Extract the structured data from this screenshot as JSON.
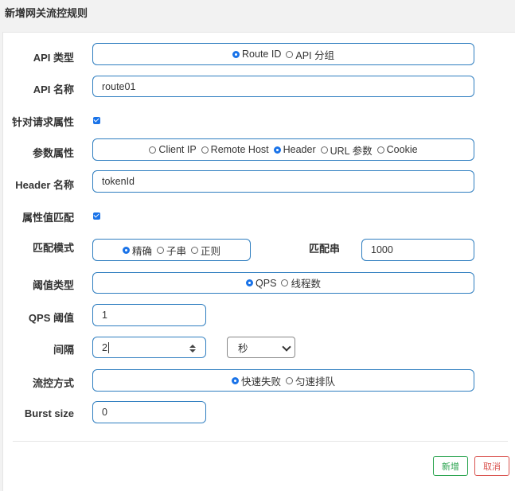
{
  "modal": {
    "title": "新增网关流控规则"
  },
  "form": {
    "api_type": {
      "label": "API 类型",
      "options": [
        "Route ID",
        "API 分组"
      ],
      "selected": "Route ID"
    },
    "api_name": {
      "label": "API 名称",
      "value": "route01"
    },
    "request_attr": {
      "label": "针对请求属性",
      "checked": true
    },
    "param_attr": {
      "label": "参数属性",
      "options": [
        "Client IP",
        "Remote Host",
        "Header",
        "URL 参数",
        "Cookie"
      ],
      "selected": "Header"
    },
    "header_name": {
      "label": "Header 名称",
      "value": "tokenId"
    },
    "attr_match": {
      "label": "属性值匹配",
      "checked": true
    },
    "match_mode": {
      "label": "匹配模式",
      "options": [
        "精确",
        "子串",
        "正则"
      ],
      "selected": "精确"
    },
    "match_string": {
      "label": "匹配串",
      "value": "1000"
    },
    "threshold_type": {
      "label": "阈值类型",
      "options": [
        "QPS",
        "线程数"
      ],
      "selected": "QPS"
    },
    "qps_threshold": {
      "label": "QPS 阈值",
      "value": "1"
    },
    "interval": {
      "label": "间隔",
      "value": "2",
      "unit": "秒"
    },
    "control_mode": {
      "label": "流控方式",
      "options": [
        "快速失败",
        "匀速排队"
      ],
      "selected": "快速失败"
    },
    "burst_size": {
      "label": "Burst size",
      "value": "0"
    }
  },
  "footer": {
    "add_label": "新增",
    "cancel_label": "取消"
  },
  "colors": {
    "input_border": "#2f7ec0",
    "radio_selected": "#1a73e8",
    "add_button": "#2aa44f",
    "cancel_button": "#d9534f"
  }
}
